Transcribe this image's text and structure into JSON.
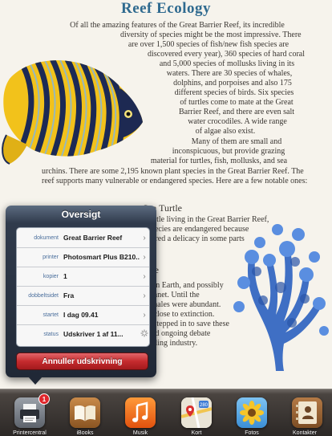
{
  "document": {
    "title": "Reef Ecology",
    "paragraph_lines": [
      "Of all the amazing features of the Great Barrier Reef, its incredible",
      "diversity of species might be the most impressive. There",
      "are over 1,500 species of fish/new fish species are",
      "discovered every year), 360 species of hard coral",
      "and 5,000 species of mollusks living in its",
      "waters. There are 30 species of whales,",
      "dolphins, and porpoises and also 175",
      "different species of birds. Six species",
      "of turtles come to mate at the Great",
      "Barrier Reef, and there are even salt",
      "water crocodiles. A wide range",
      "of algae also exist.",
      "Many of them are small and",
      "inconspicuous, but provide grazing",
      "material for turtles, fish, mollusks, and sea",
      "urchins. There are some 2,195 known plant species in the Great Barrier Reef. The",
      "reef supports many vulnerable or endangered species. Here are a few notable ones:"
    ],
    "subheading": "Sea Turtle",
    "partial_lines_1": [
      "turtle living in the Great Barrier Reef,",
      "species are endangered because",
      "dered a delicacy in some parts"
    ],
    "partial_word": "ale",
    "partial_lines_2": [
      "l on Earth, and possibly",
      "planet. Until the",
      "whales were abundant.",
      "n close to extinction.",
      "y stepped in to save these",
      "ged ongoing debate",
      "haling industry."
    ]
  },
  "popover": {
    "title": "Oversigt",
    "rows": [
      {
        "label": "dokument",
        "value": "Great Barrier Reef",
        "chevron": true
      },
      {
        "label": "printer",
        "value": "Photosmart Plus B210...",
        "chevron": true
      },
      {
        "label": "kopier",
        "value": "1",
        "chevron": true
      },
      {
        "label": "dobbeltsidet",
        "value": "Fra",
        "chevron": true
      },
      {
        "label": "startet",
        "value": "I dag 09.41",
        "chevron": true
      },
      {
        "label": "status",
        "value": "Udskriver 1 af 11...",
        "chevron": false
      }
    ],
    "cancel_label": "Annuller udskrivning"
  },
  "dock": {
    "apps": [
      {
        "name": "Printercentral",
        "icon": "printer-icon",
        "badge": "1"
      },
      {
        "name": "iBooks",
        "icon": "ibooks-icon"
      },
      {
        "name": "Musik",
        "icon": "music-icon"
      },
      {
        "name": "Kort",
        "icon": "maps-icon"
      },
      {
        "name": "Fotos",
        "icon": "photos-icon"
      },
      {
        "name": "Kontakter",
        "icon": "contacts-icon"
      }
    ]
  },
  "colors": {
    "title_blue": "#2f6a8f",
    "cancel_red": "#c52b2e",
    "badge_red": "#e0262b"
  }
}
